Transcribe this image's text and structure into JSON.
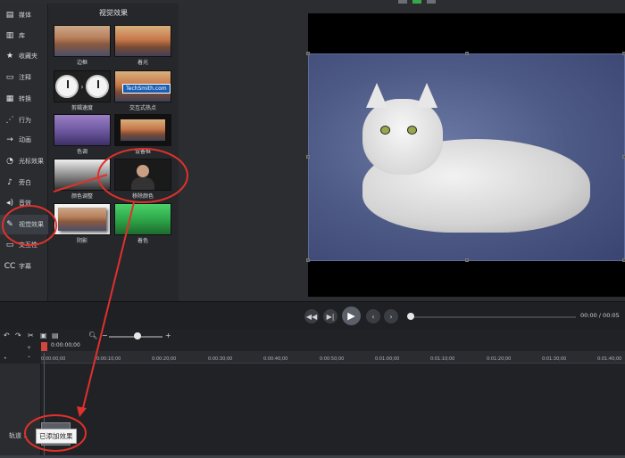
{
  "sidebar": {
    "items": [
      {
        "label": "媒体",
        "icon": "film-icon"
      },
      {
        "label": "库",
        "icon": "library-icon"
      },
      {
        "label": "收藏夹",
        "icon": "star-icon"
      },
      {
        "label": "注释",
        "icon": "annotation-icon"
      },
      {
        "label": "转换",
        "icon": "transition-icon"
      },
      {
        "label": "行为",
        "icon": "behavior-icon"
      },
      {
        "label": "动画",
        "icon": "animation-icon"
      },
      {
        "label": "光标效果",
        "icon": "cursor-icon"
      },
      {
        "label": "旁白",
        "icon": "microphone-icon"
      },
      {
        "label": "音效",
        "icon": "speaker-icon"
      },
      {
        "label": "视觉效果",
        "icon": "visual-effects-icon"
      },
      {
        "label": "交互性",
        "icon": "interactive-icon"
      },
      {
        "label": "字幕",
        "icon": "caption-icon"
      }
    ]
  },
  "effects_panel": {
    "title": "视觉效果",
    "tiles": [
      {
        "label": "边框"
      },
      {
        "label": "着光"
      },
      {
        "label": "剪辑速度"
      },
      {
        "label": "交互式热点",
        "badge": "TechSmith.com"
      },
      {
        "label": "色调"
      },
      {
        "label": "设备框"
      },
      {
        "label": "颜色调整"
      },
      {
        "label": "移除颜色"
      },
      {
        "label": "阴影"
      },
      {
        "label": "着色"
      }
    ]
  },
  "playback": {
    "timecode": "00:00 / 00:05"
  },
  "timeline": {
    "playhead_time": "0:00:00;00",
    "ticks": [
      "0:00:00;00",
      "0:00:10;00",
      "0:00:20;00",
      "0:00:30;00",
      "0:00:40;00",
      "0:00:50;00",
      "0:01:00;00",
      "0:01:10;00",
      "0:01:20;00",
      "0:01:30;00",
      "0:01:40;00"
    ],
    "track_label": "轨道 1",
    "tooltip": "已添加效果"
  },
  "colors": {
    "annotation_red": "#e0312b",
    "playhead": "#d24640",
    "accent_green": "#37a84a"
  }
}
